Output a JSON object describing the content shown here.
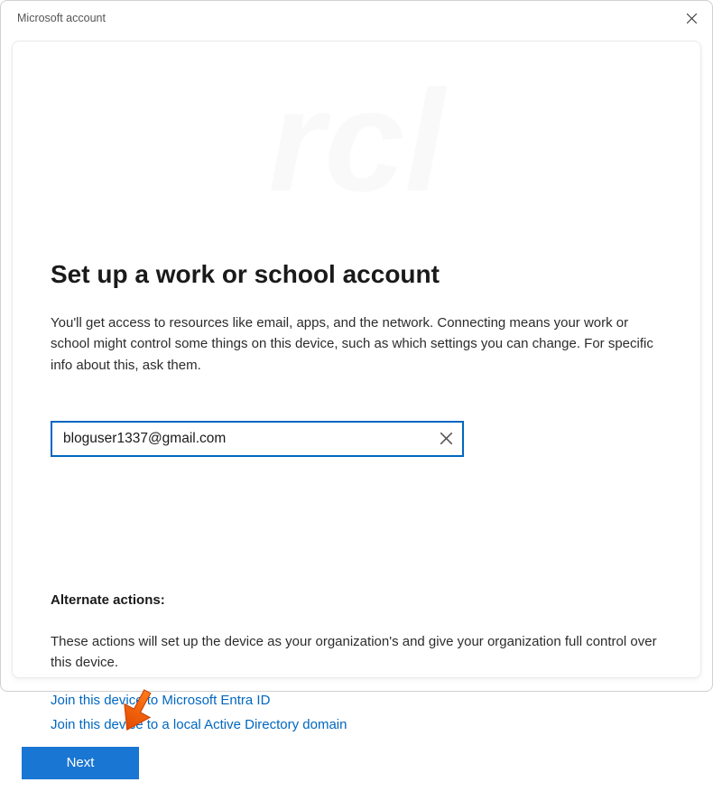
{
  "window": {
    "title": "Microsoft account"
  },
  "page": {
    "heading": "Set up a work or school account",
    "description": "You'll get access to resources like email, apps, and the network. Connecting means your work or school might control some things on this device, such as which settings you can change. For specific info about this, ask them."
  },
  "form": {
    "email_value": "bloguser1337@gmail.com"
  },
  "alternate": {
    "heading": "Alternate actions:",
    "description": "These actions will set up the device as your organization's and give your organization full control over this device.",
    "link_entra": "Join this device to Microsoft Entra ID",
    "link_ad": "Join this device to a local Active Directory domain"
  },
  "buttons": {
    "next": "Next"
  }
}
